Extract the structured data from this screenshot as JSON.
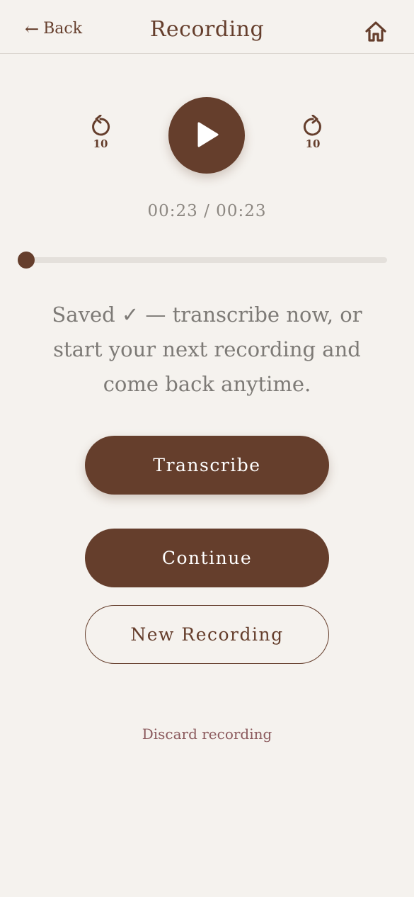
{
  "header": {
    "back_arrow": "←",
    "back_label": "Back",
    "title": "Recording",
    "home_icon": "home-icon"
  },
  "player": {
    "rewind_icon": "rewind-10-icon",
    "rewind_seconds": "10",
    "play_icon": "play-icon",
    "forward_icon": "forward-10-icon",
    "forward_seconds": "10",
    "time_display": "00:23 / 00:23",
    "progress_fraction": 0
  },
  "message": "Saved ✓ — transcribe now, or start your next recording and come back anytime.",
  "actions": {
    "transcribe_label": "Transcribe",
    "continue_label": "Continue",
    "new_recording_label": "New Recording",
    "discard_label": "Discard recording"
  },
  "colors": {
    "accent": "#653e2c",
    "background": "#f5f2ee",
    "muted_text": "#7d7a76",
    "discard_text": "#8b5a5d"
  }
}
